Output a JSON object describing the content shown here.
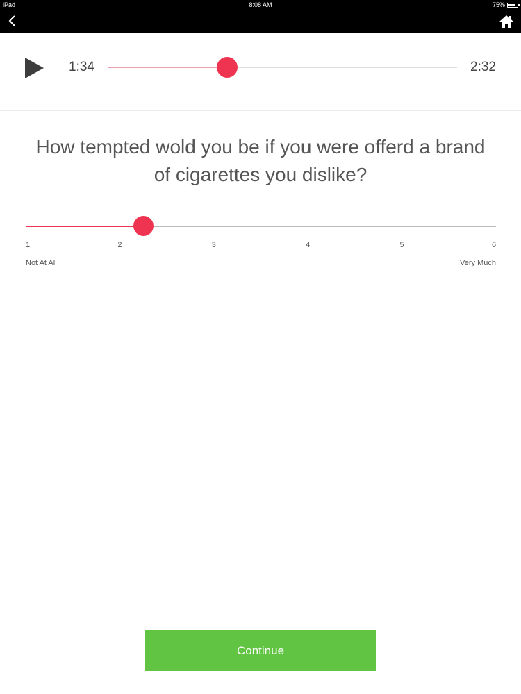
{
  "status_bar": {
    "device": "iPad",
    "time": "8:08 AM",
    "battery": "75%",
    "battery_level": 0.75
  },
  "nav": {
    "back_icon": "chevron-left-icon",
    "home_icon": "home-icon"
  },
  "player": {
    "play_icon": "play-icon",
    "current_time": "1:34",
    "total_time": "2:32",
    "progress": 0.34,
    "accent_color": "#ef3452"
  },
  "question": {
    "text": "How tempted wold you be if you were offerd a brand of cigarettes you dislike?"
  },
  "scale": {
    "ticks": [
      "1",
      "2",
      "3",
      "4",
      "5",
      "6"
    ],
    "min": 1,
    "max": 6,
    "value": 2.25,
    "low_label": "Not At All",
    "high_label": "Very Much"
  },
  "actions": {
    "continue_label": "Continue",
    "continue_color": "#61c443"
  }
}
